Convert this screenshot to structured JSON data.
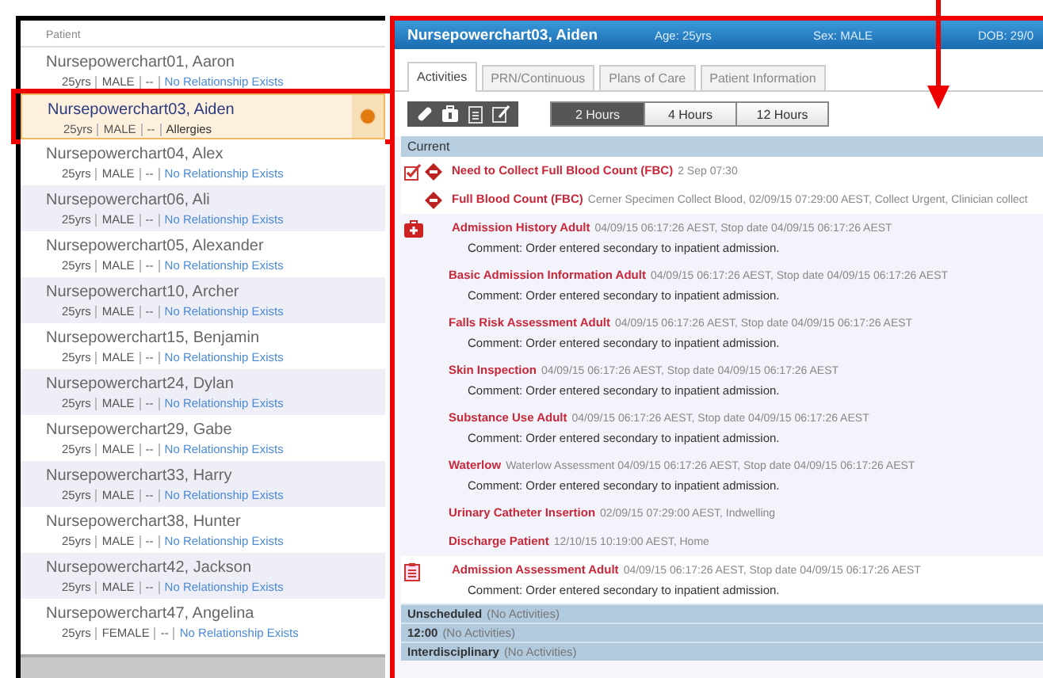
{
  "patient_list": {
    "header": "Patient",
    "patients": [
      {
        "name": "Nursepowerchart01, Aaron",
        "age": "25yrs",
        "sex": "MALE",
        "dash": "--",
        "relation": "No Relationship Exists",
        "link": true,
        "selected": false,
        "highlighted": false,
        "alert": false
      },
      {
        "name": "Nursepowerchart03, Aiden",
        "age": "25yrs",
        "sex": "MALE",
        "dash": "--",
        "relation": "Allergies",
        "link": false,
        "selected": true,
        "highlighted": true,
        "alert": true
      },
      {
        "name": "Nursepowerchart04, Alex",
        "age": "25yrs",
        "sex": "MALE",
        "dash": "--",
        "relation": "No Relationship Exists",
        "link": true,
        "selected": false,
        "highlighted": false,
        "alert": false
      },
      {
        "name": "Nursepowerchart06, Ali",
        "age": "25yrs",
        "sex": "MALE",
        "dash": "--",
        "relation": "No Relationship Exists",
        "link": true,
        "selected": false,
        "highlighted": false,
        "alert": false
      },
      {
        "name": "Nursepowerchart05, Alexander",
        "age": "25yrs",
        "sex": "MALE",
        "dash": "--",
        "relation": "No Relationship Exists",
        "link": true,
        "selected": false,
        "highlighted": false,
        "alert": false
      },
      {
        "name": "Nursepowerchart10, Archer",
        "age": "25yrs",
        "sex": "MALE",
        "dash": "--",
        "relation": "No Relationship Exists",
        "link": true,
        "selected": false,
        "highlighted": false,
        "alert": false
      },
      {
        "name": "Nursepowerchart15, Benjamin",
        "age": "25yrs",
        "sex": "MALE",
        "dash": "--",
        "relation": "No Relationship Exists",
        "link": true,
        "selected": false,
        "highlighted": false,
        "alert": false
      },
      {
        "name": "Nursepowerchart24, Dylan",
        "age": "25yrs",
        "sex": "MALE",
        "dash": "--",
        "relation": "No Relationship Exists",
        "link": true,
        "selected": false,
        "highlighted": false,
        "alert": false
      },
      {
        "name": "Nursepowerchart29, Gabe",
        "age": "25yrs",
        "sex": "MALE",
        "dash": "--",
        "relation": "No Relationship Exists",
        "link": true,
        "selected": false,
        "highlighted": false,
        "alert": false
      },
      {
        "name": "Nursepowerchart33, Harry",
        "age": "25yrs",
        "sex": "MALE",
        "dash": "--",
        "relation": "No Relationship Exists",
        "link": true,
        "selected": false,
        "highlighted": false,
        "alert": false
      },
      {
        "name": "Nursepowerchart38, Hunter",
        "age": "25yrs",
        "sex": "MALE",
        "dash": "--",
        "relation": "No Relationship Exists",
        "link": true,
        "selected": false,
        "highlighted": false,
        "alert": false
      },
      {
        "name": "Nursepowerchart42, Jackson",
        "age": "25yrs",
        "sex": "MALE",
        "dash": "--",
        "relation": "No Relationship Exists",
        "link": true,
        "selected": false,
        "highlighted": false,
        "alert": false
      },
      {
        "name": "Nursepowerchart47, Angelina",
        "age": "25yrs",
        "sex": "FEMALE",
        "dash": "--",
        "relation": "No Relationship Exists",
        "link": true,
        "selected": false,
        "highlighted": false,
        "alert": false
      }
    ]
  },
  "banner": {
    "name": "Nursepowerchart03, Aiden",
    "age": "Age: 25yrs",
    "sex": "Sex: MALE",
    "dob": "DOB: 29/0"
  },
  "tabs": [
    {
      "label": "Activities",
      "selected": true
    },
    {
      "label": "PRN/Continuous",
      "selected": false
    },
    {
      "label": "Plans of Care",
      "selected": false
    },
    {
      "label": "Patient Information",
      "selected": false
    }
  ],
  "toolbar": {
    "tools": [
      {
        "kind": "pill"
      },
      {
        "kind": "case"
      },
      {
        "kind": "clipboard"
      },
      {
        "kind": "edit"
      }
    ],
    "ranges": [
      {
        "label": "2 Hours",
        "selected": true
      },
      {
        "label": "4 Hours",
        "selected": false
      },
      {
        "label": "12 Hours",
        "selected": false
      }
    ]
  },
  "current": {
    "title": "Current",
    "activities": [
      {
        "kind": "task",
        "shaded": false,
        "title": "Need to Collect Full Blood Count (FBC)",
        "detail": "2 Sep 07:30"
      },
      {
        "kind": "order",
        "shaded": false,
        "title": "Full Blood Count (FBC)",
        "detail": "Cerner Specimen Collect Blood, 02/09/15 07:29:00 AEST, Collect Urgent, Clinician collect"
      },
      {
        "kind": "kit",
        "shaded": true,
        "title": "Admission History Adult",
        "detail": "04/09/15 06:17:26 AEST, Stop date 04/09/15 06:17:26 AEST",
        "comment": "Comment: Order entered secondary to inpatient admission."
      },
      {
        "kind": "none",
        "shaded": true,
        "title": "Basic Admission Information Adult",
        "detail": "04/09/15 06:17:26 AEST, Stop date 04/09/15 06:17:26 AEST",
        "comment": "Comment: Order entered secondary to inpatient admission."
      },
      {
        "kind": "none",
        "shaded": true,
        "title": "Falls Risk Assessment Adult",
        "detail": "04/09/15 06:17:26 AEST, Stop date 04/09/15 06:17:26 AEST",
        "comment": "Comment: Order entered secondary to inpatient admission."
      },
      {
        "kind": "none",
        "shaded": true,
        "title": "Skin Inspection",
        "detail": "04/09/15 06:17:26 AEST, Stop date 04/09/15 06:17:26 AEST",
        "comment": "Comment: Order entered secondary to inpatient admission."
      },
      {
        "kind": "none",
        "shaded": true,
        "title": "Substance Use Adult",
        "detail": "04/09/15 06:17:26 AEST, Stop date 04/09/15 06:17:26 AEST",
        "comment": "Comment: Order entered secondary to inpatient admission."
      },
      {
        "kind": "none",
        "shaded": true,
        "title": "Waterlow",
        "detail": "Waterlow Assessment 04/09/15 06:17:26 AEST, Stop date 04/09/15 06:17:26 AEST",
        "comment": "Comment: Order entered secondary to inpatient admission."
      },
      {
        "kind": "none",
        "shaded": true,
        "title": "Urinary Catheter Insertion",
        "detail": "02/09/15 07:29:00 AEST, Indwelling"
      },
      {
        "kind": "none",
        "shaded": true,
        "title": "Discharge Patient",
        "detail": "12/10/15 10:19:00 AEST, Home"
      },
      {
        "kind": "clipboard",
        "shaded": false,
        "title": "Admission Assessment Adult",
        "detail": "04/09/15 06:17:26 AEST, Stop date 04/09/15 06:17:26 AEST",
        "comment": "Comment: Order entered secondary to inpatient admission."
      }
    ]
  },
  "sections": [
    {
      "title": "Unscheduled",
      "note": "(No Activities)"
    },
    {
      "title": "12:00",
      "note": "(No Activities)"
    },
    {
      "title": "Interdisciplinary",
      "note": "(No Activities)"
    }
  ],
  "annotation": {
    "arrow": true
  }
}
